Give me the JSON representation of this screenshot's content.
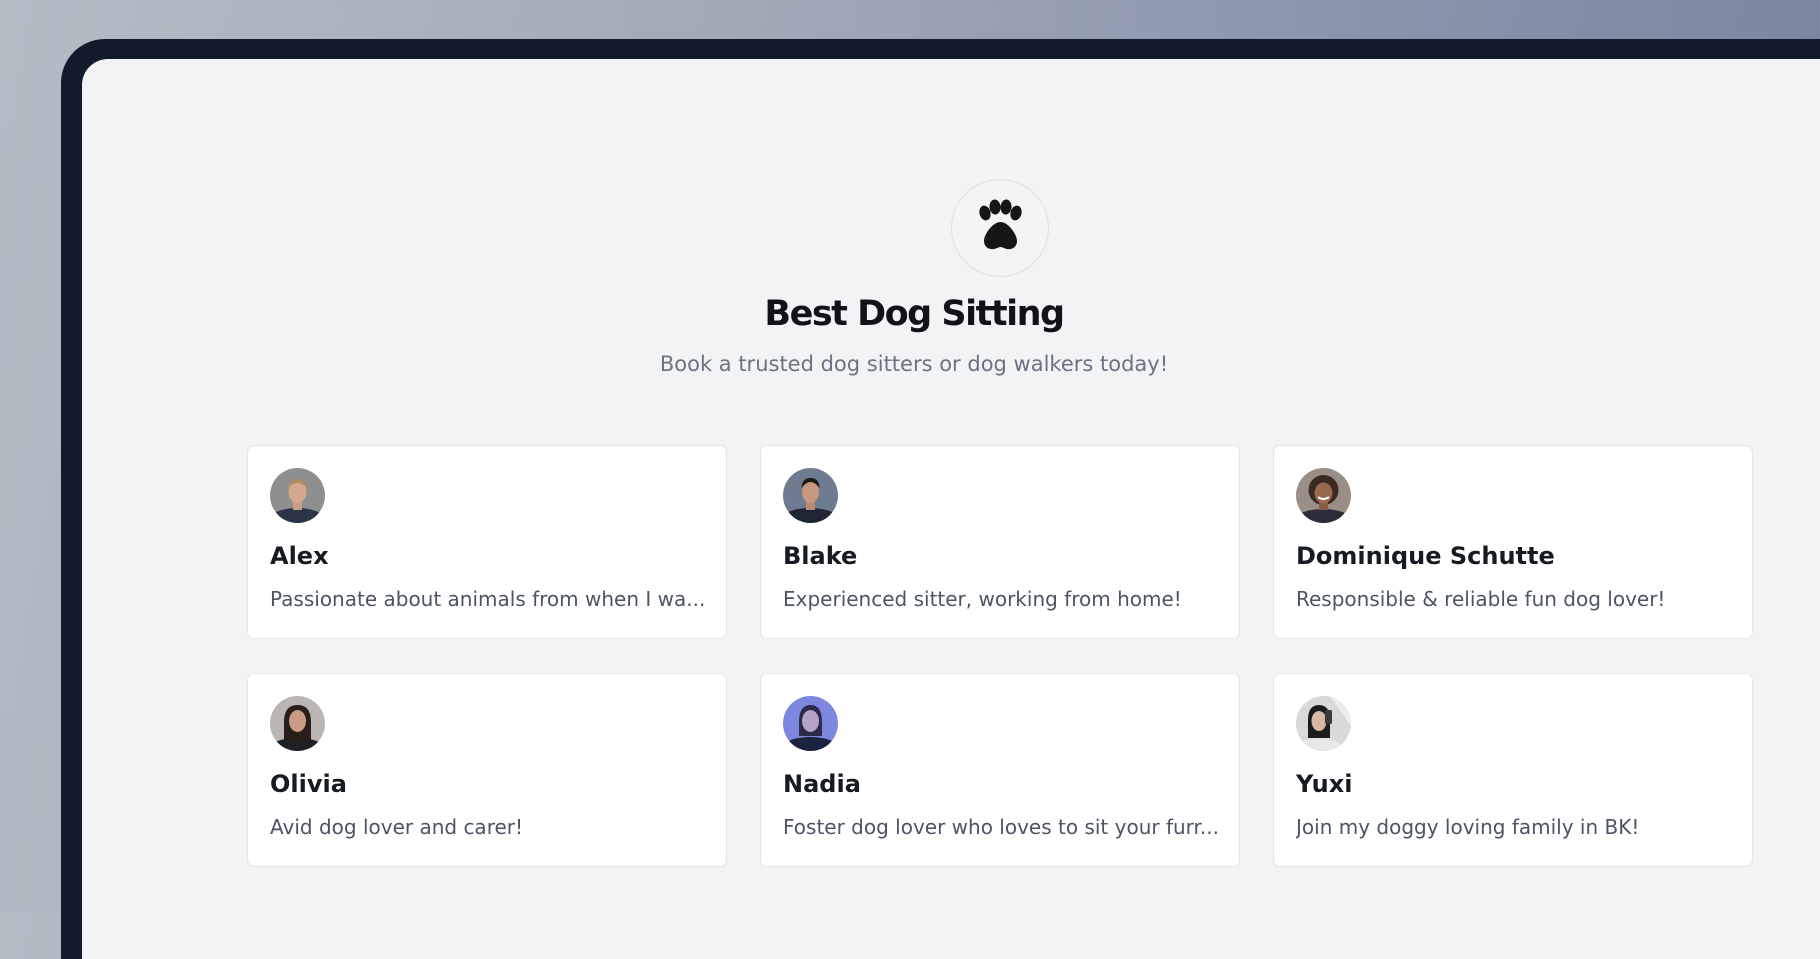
{
  "app": {
    "title": "Best Dog Sitting",
    "subtitle": "Book a trusted dog sitters or dog walkers today!",
    "logo_icon": "paw-icon"
  },
  "sitters": [
    {
      "name": "Alex",
      "description": "Passionate about animals from when I wa..."
    },
    {
      "name": "Blake",
      "description": "Experienced sitter, working from home!"
    },
    {
      "name": "Dominique Schutte",
      "description": "Responsible & reliable fun dog lover!"
    },
    {
      "name": "Olivia",
      "description": "Avid dog lover and carer!"
    },
    {
      "name": "Nadia",
      "description": "Foster dog lover who loves to sit your furr..."
    },
    {
      "name": "Yuxi",
      "description": "Join my doggy loving family in BK!"
    }
  ],
  "colors": {
    "background": "#f2f3f5",
    "card": "#ffffff",
    "title": "#111318",
    "muted": "#6b7280",
    "frame": "#121b2b"
  }
}
